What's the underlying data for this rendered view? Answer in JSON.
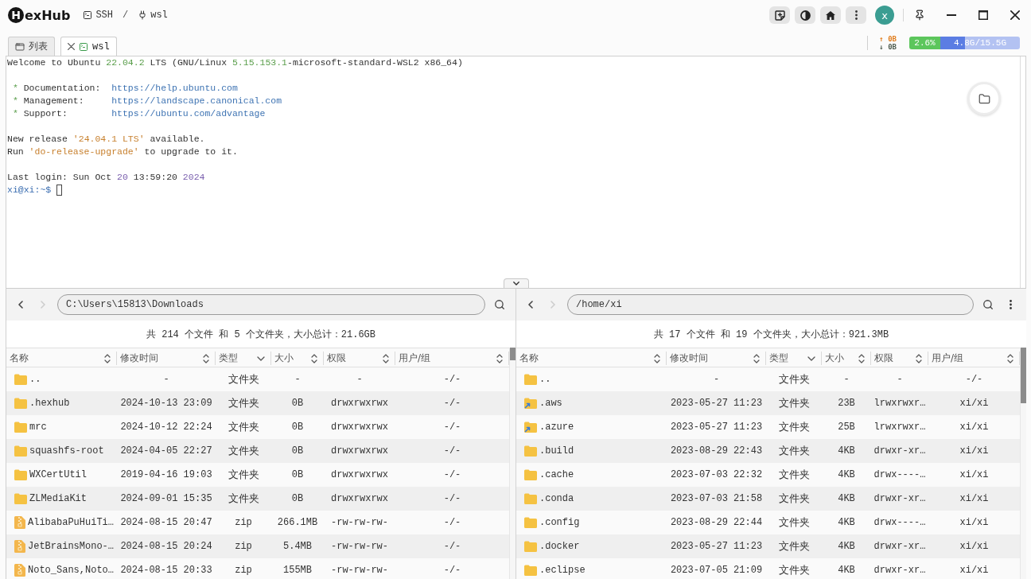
{
  "title_bar": {
    "logo": {
      "mark": "H",
      "text": "exHub"
    },
    "breadcrumb": {
      "items": [
        {
          "kind": "group",
          "label": "SSH"
        },
        {
          "kind": "session",
          "label": "wsl"
        }
      ],
      "separator": "/"
    },
    "avatar": "x"
  },
  "tabs": [
    {
      "kind": "list",
      "label": "列表",
      "selected": false,
      "closable": false
    },
    {
      "kind": "terminal",
      "label": "wsl",
      "selected": true,
      "closable": true
    }
  ],
  "status": {
    "upload": "↑ 0B",
    "download": "↓ 0B",
    "cpu": "2.6%",
    "memory": {
      "reading": "4.8G/15.5G",
      "level": 0.31
    }
  },
  "terminal": {
    "cursor": true,
    "blocks": [
      {
        "lines": [
          [
            {
              "kind": "text",
              "text": "Welcome to Ubuntu "
            },
            {
              "kind": "number",
              "text": "22.04.2"
            },
            {
              "kind": "text",
              "text": " LTS (GNU/Linux "
            },
            {
              "kind": "number",
              "text": "5.15.153.1"
            },
            {
              "kind": "text",
              "text": "-microsoft-standard-WSL2 x86_64)"
            }
          ]
        ]
      },
      {
        "lines": [
          [
            {
              "kind": "bullet",
              "text": " *"
            },
            {
              "kind": "text",
              "text": " Documentation:  "
            },
            {
              "kind": "link",
              "text": "https://help.ubuntu.com"
            }
          ],
          [
            {
              "kind": "bullet",
              "text": " *"
            },
            {
              "kind": "text",
              "text": " Management:     "
            },
            {
              "kind": "link",
              "text": "https://landscape.canonical.com"
            }
          ],
          [
            {
              "kind": "bullet",
              "text": " *"
            },
            {
              "kind": "text",
              "text": " Support:        "
            },
            {
              "kind": "link",
              "text": "https://ubuntu.com/advantage"
            }
          ]
        ]
      },
      {
        "lines": [
          [
            {
              "kind": "text",
              "text": "New release "
            },
            {
              "kind": "string",
              "text": "'24.04.1 LTS'"
            },
            {
              "kind": "text",
              "text": " available."
            }
          ],
          [
            {
              "kind": "text",
              "text": "Run "
            },
            {
              "kind": "string",
              "text": "'do-release-upgrade'"
            },
            {
              "kind": "text",
              "text": " to upgrade to it."
            }
          ]
        ]
      },
      {
        "lines": [
          [
            {
              "kind": "text",
              "text": "Last login: Sun Oct "
            },
            {
              "kind": "date",
              "text": "20"
            },
            {
              "kind": "text",
              "text": " 13:59:20 "
            },
            {
              "kind": "date",
              "text": "2024"
            }
          ],
          [
            {
              "kind": "prompt",
              "text": "xi@xi:~$"
            }
          ]
        ]
      }
    ]
  },
  "file_panes": [
    {
      "nav": [
        {
          "kind": "back",
          "disabled": false
        },
        {
          "kind": "forward",
          "disabled": true
        }
      ],
      "path": "C:\\Users\\15813\\Downloads",
      "menu_button": false,
      "summary": "共 214 个文件 和 5 个文件夹，大小总计：21.6GB",
      "columns": [
        {
          "label": "名称",
          "sorted": false
        },
        {
          "label": "修改时间",
          "sorted": false
        },
        {
          "label": "类型",
          "sorted": true
        },
        {
          "label": "大小",
          "sorted": false
        },
        {
          "label": "权限",
          "sorted": false
        },
        {
          "label": "用户/组",
          "sorted": false
        }
      ],
      "rows": [
        {
          "kind": "folder",
          "name": "..",
          "modified": "-",
          "type": "文件夹",
          "size": "-",
          "permissions": "-",
          "owner": "-/-"
        },
        {
          "kind": "folder",
          "name": ".hexhub",
          "modified": "2024-10-13 23:09",
          "type": "文件夹",
          "size": "0B",
          "permissions": "drwxrwxrwx",
          "owner": "-/-"
        },
        {
          "kind": "folder",
          "name": "mrc",
          "modified": "2024-10-12 22:24",
          "type": "文件夹",
          "size": "0B",
          "permissions": "drwxrwxrwx",
          "owner": "-/-"
        },
        {
          "kind": "folder",
          "name": "squashfs-root",
          "modified": "2024-04-05 22:27",
          "type": "文件夹",
          "size": "0B",
          "permissions": "drwxrwxrwx",
          "owner": "-/-"
        },
        {
          "kind": "folder",
          "name": "WXCertUtil",
          "modified": "2019-04-16 19:03",
          "type": "文件夹",
          "size": "0B",
          "permissions": "drwxrwxrwx",
          "owner": "-/-"
        },
        {
          "kind": "folder",
          "name": "ZLMediaKit",
          "modified": "2024-09-01 15:35",
          "type": "文件夹",
          "size": "0B",
          "permissions": "drwxrwxrwx",
          "owner": "-/-"
        },
        {
          "kind": "zip",
          "name": "AlibabaPuHuiTi…",
          "modified": "2024-08-15 20:47",
          "type": "zip",
          "size": "266.1MB",
          "permissions": "-rw-rw-rw-",
          "owner": "-/-"
        },
        {
          "kind": "zip",
          "name": "JetBrainsMono-…",
          "modified": "2024-08-15 20:24",
          "type": "zip",
          "size": "5.4MB",
          "permissions": "-rw-rw-rw-",
          "owner": "-/-"
        },
        {
          "kind": "zip",
          "name": "Noto_Sans,Noto…",
          "modified": "2024-08-15 20:33",
          "type": "zip",
          "size": "155MB",
          "permissions": "-rw-rw-rw-",
          "owner": "-/-"
        }
      ]
    },
    {
      "nav": [
        {
          "kind": "back",
          "disabled": false
        },
        {
          "kind": "forward",
          "disabled": true
        }
      ],
      "path": "/home/xi",
      "menu_button": true,
      "summary": "共 17 个文件 和 19 个文件夹，大小总计：921.3MB",
      "columns": [
        {
          "label": "名称",
          "sorted": false
        },
        {
          "label": "修改时间",
          "sorted": false
        },
        {
          "label": "类型",
          "sorted": true
        },
        {
          "label": "大小",
          "sorted": false
        },
        {
          "label": "权限",
          "sorted": false
        },
        {
          "label": "用户/组",
          "sorted": false
        }
      ],
      "rows": [
        {
          "kind": "folder",
          "name": "..",
          "modified": "-",
          "type": "文件夹",
          "size": "-",
          "permissions": "-",
          "owner": "-/-"
        },
        {
          "kind": "link",
          "name": ".aws",
          "modified": "2023-05-27 11:23",
          "type": "文件夹",
          "size": "23B",
          "permissions": "lrwxrwxr…",
          "owner": "xi/xi"
        },
        {
          "kind": "link",
          "name": ".azure",
          "modified": "2023-05-27 11:23",
          "type": "文件夹",
          "size": "25B",
          "permissions": "lrwxrwxr…",
          "owner": "xi/xi"
        },
        {
          "kind": "folder",
          "name": ".build",
          "modified": "2023-08-29 22:43",
          "type": "文件夹",
          "size": "4KB",
          "permissions": "drwxr-xr…",
          "owner": "xi/xi"
        },
        {
          "kind": "folder",
          "name": ".cache",
          "modified": "2023-07-03 22:32",
          "type": "文件夹",
          "size": "4KB",
          "permissions": "drwx----…",
          "owner": "xi/xi"
        },
        {
          "kind": "folder",
          "name": ".conda",
          "modified": "2023-07-03 21:58",
          "type": "文件夹",
          "size": "4KB",
          "permissions": "drwxr-xr…",
          "owner": "xi/xi"
        },
        {
          "kind": "folder",
          "name": ".config",
          "modified": "2023-08-29 22:44",
          "type": "文件夹",
          "size": "4KB",
          "permissions": "drwx----…",
          "owner": "xi/xi"
        },
        {
          "kind": "folder",
          "name": ".docker",
          "modified": "2023-05-27 11:23",
          "type": "文件夹",
          "size": "4KB",
          "permissions": "drwxr-xr…",
          "owner": "xi/xi"
        },
        {
          "kind": "folder",
          "name": ".eclipse",
          "modified": "2023-07-05 21:09",
          "type": "文件夹",
          "size": "4KB",
          "permissions": "drwxr-xr…",
          "owner": "xi/xi"
        }
      ]
    }
  ]
}
